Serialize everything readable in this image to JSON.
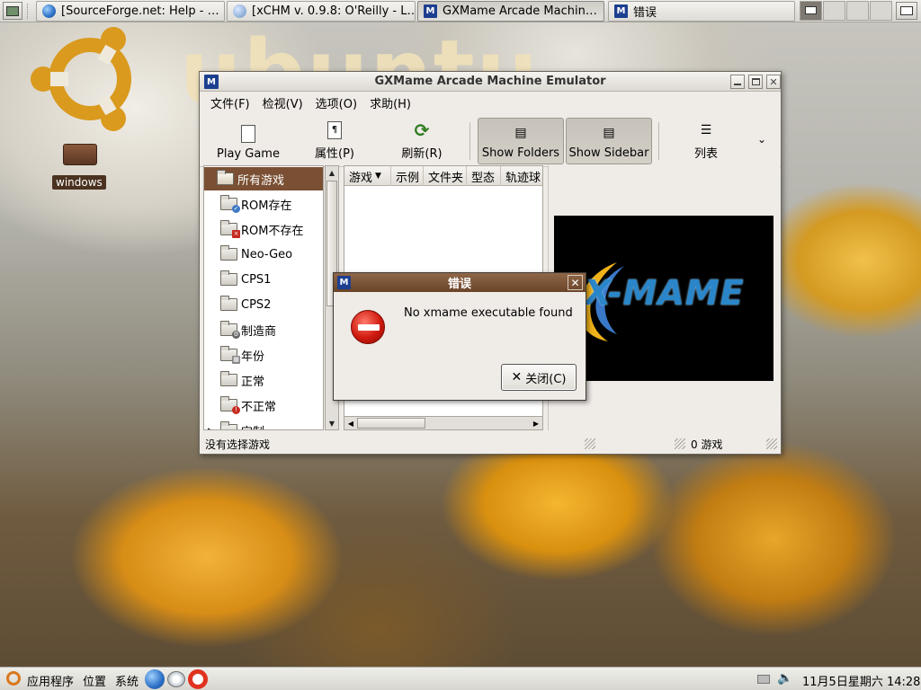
{
  "taskbar": {
    "tasks": [
      {
        "label": "[SourceForge.net: Help - …",
        "icon": "globe-icon"
      },
      {
        "label": "[xCHM v. 0.9.8: O'Reilly - L…",
        "icon": "chm-icon"
      },
      {
        "label": "GXMame Arcade Machin…",
        "icon": "gxmame-icon"
      },
      {
        "label": "错误",
        "icon": "gxmame-icon"
      }
    ]
  },
  "desktop": {
    "drive_label": "windows",
    "ubuntu_word": "ubuntu"
  },
  "window": {
    "title": "GXMame Arcade Machine Emulator",
    "menu": [
      "文件(F)",
      "检视(V)",
      "选项(O)",
      "求助(H)"
    ],
    "toolbar": {
      "play_game": "Play Game",
      "properties": "属性(P)",
      "refresh": "刷新(R)",
      "show_folders": "Show Folders",
      "show_sidebar": "Show Sidebar",
      "list": "列表"
    },
    "folders": [
      "所有游戏",
      "ROM存在",
      "ROM不存在",
      "Neo-Geo",
      "CPS1",
      "CPS2",
      "制造商",
      "年份",
      "正常",
      "不正常",
      "定制"
    ],
    "columns": [
      "游戏",
      "示例",
      "文件夹",
      "型态",
      "轨迹球"
    ],
    "status_left": "没有选择游戏",
    "status_right": "0 游戏",
    "preview_logo_text": "X-MAME"
  },
  "dialog": {
    "title": "错误",
    "message": "No xmame executable found",
    "close_label": "关闭(C)"
  },
  "bottom_panel": {
    "applications": "应用程序",
    "places": "位置",
    "system": "系统",
    "clock": "11月5日星期六 14:28"
  },
  "colors": {
    "selection": "#7a4f33",
    "dialog_title": "#7b5436",
    "window_bg": "#efebe7"
  }
}
